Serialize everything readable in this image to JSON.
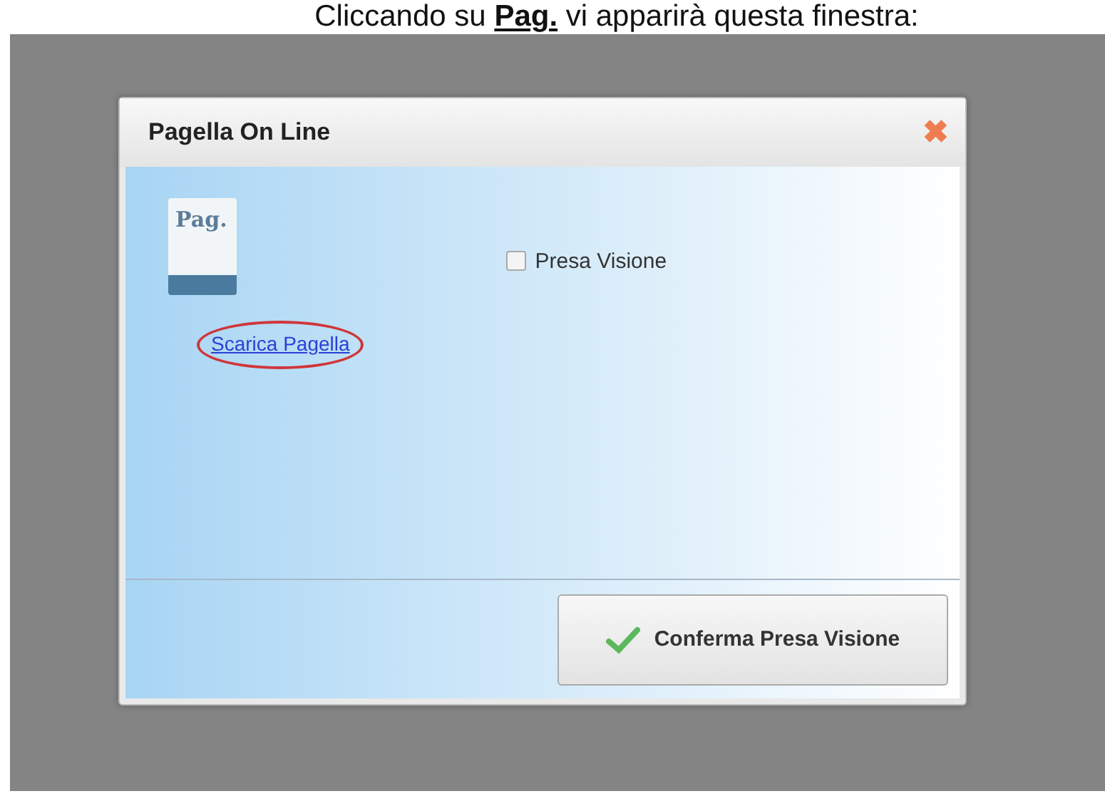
{
  "caption": "Cliccando su **Pag.** vi apparirà questa finestra:",
  "dialog": {
    "title": "Pagella On Line",
    "close": "✖",
    "document_icon": {
      "label": "Pag."
    },
    "download_link": {
      "label": "Scarica Pagella",
      "circled": true
    },
    "checkbox": {
      "label": "Presa Visione",
      "checked": false
    },
    "confirm_button": {
      "label": "Conferma Presa Visione"
    }
  }
}
